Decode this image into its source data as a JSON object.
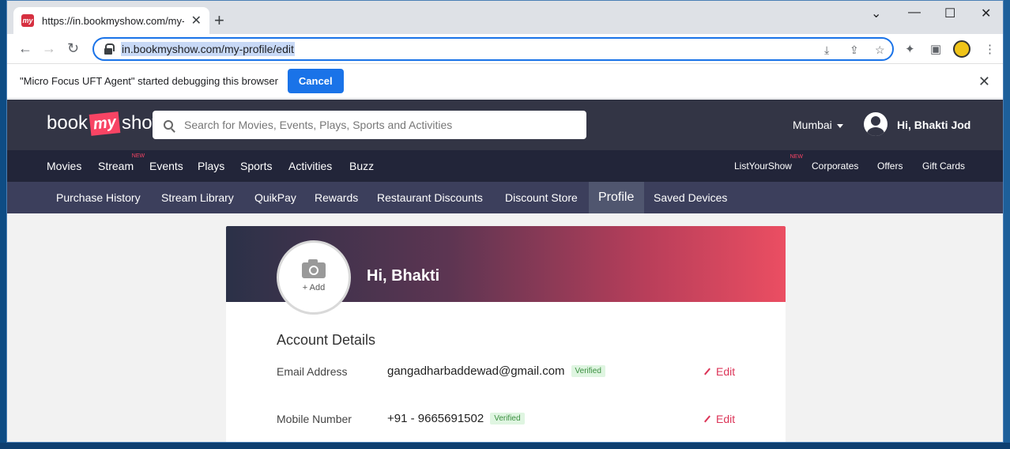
{
  "browser": {
    "tab_title": "https://in.bookmyshow.com/my-",
    "favicon_text": "my",
    "new_tab": "+",
    "tab_close": "✕",
    "url": "in.bookmyshow.com/my-profile/edit"
  },
  "window_controls": {
    "collapse": "⌄",
    "minimize": "—",
    "maximize": "☐",
    "close": "✕"
  },
  "infobar": {
    "message": "\"Micro Focus UFT Agent\" started debugging this browser",
    "cancel_label": "Cancel",
    "close": "✕"
  },
  "header": {
    "logo_left": "book",
    "logo_mid": "my",
    "logo_right": "show",
    "search_placeholder": "Search for Movies, Events, Plays, Sports and Activities",
    "city": "Mumbai",
    "user_greeting": "Hi, Bhakti Jod"
  },
  "main_nav": {
    "items": [
      "Movies",
      "Stream",
      "Events",
      "Plays",
      "Sports",
      "Activities",
      "Buzz"
    ],
    "stream_badge": "NEW",
    "right_items": [
      "ListYourShow",
      "Corporates",
      "Offers",
      "Gift Cards"
    ],
    "listyourshow_badge": "NEW"
  },
  "sub_nav": {
    "items": [
      "Purchase History",
      "Stream Library",
      "QuikPay",
      "Rewards",
      "Restaurant Discounts",
      "Discount Store",
      "Profile",
      "Saved Devices"
    ],
    "active": "Profile"
  },
  "profile": {
    "add_photo": "+ Add",
    "greeting": "Hi, Bhakti",
    "section_title": "Account Details",
    "rows": [
      {
        "label": "Email Address",
        "value": "gangadharbaddewad@gmail.com",
        "badge": "Verified",
        "action": "Edit"
      },
      {
        "label": "Mobile Number",
        "value": "+91 - 9665691502",
        "badge": "Verified",
        "action": "Edit"
      }
    ]
  },
  "colors": {
    "brand": "#f84464",
    "header_bg": "#333545",
    "nav_bg": "#222539",
    "subnav_bg": "#3c3f5c",
    "chrome_blue": "#1a73e8"
  }
}
